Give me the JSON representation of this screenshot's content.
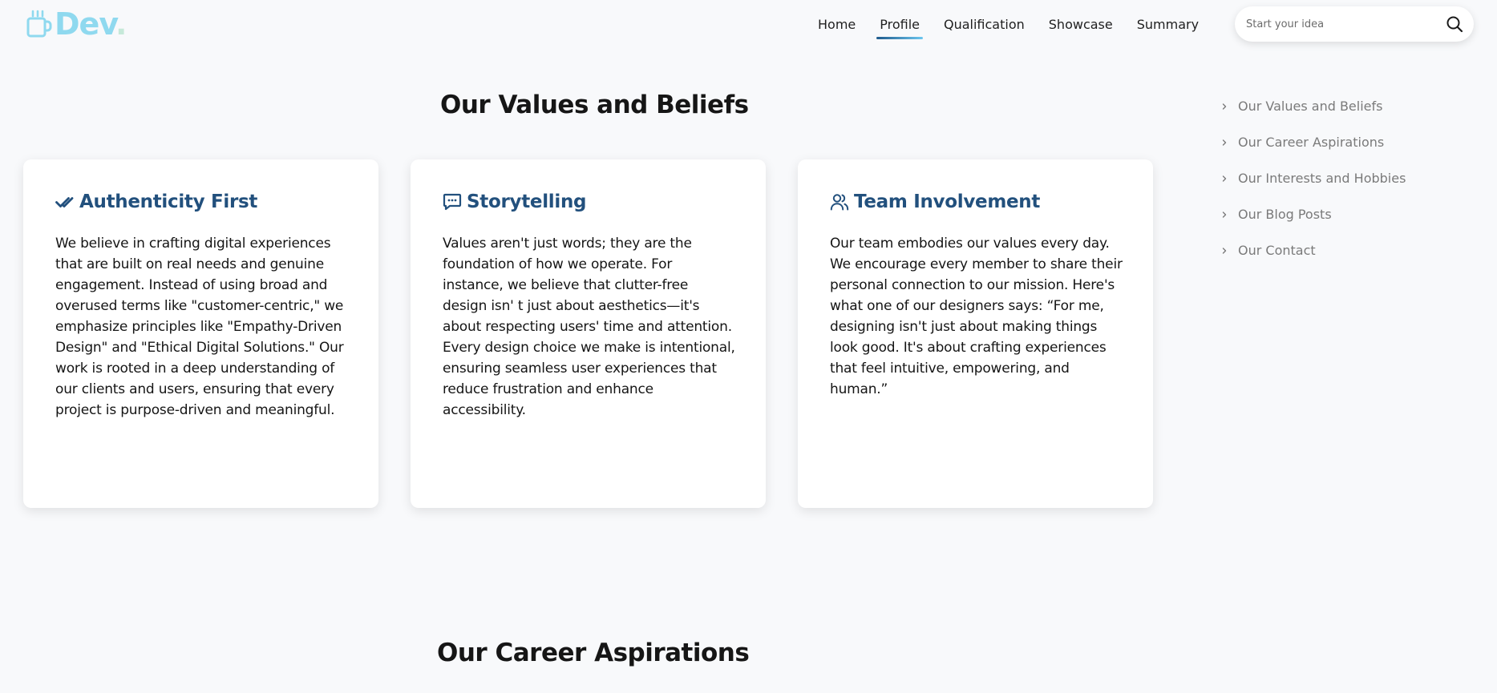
{
  "brand": {
    "name": "Dev",
    "dot": ".",
    "icon": "coffee-mug-icon",
    "color": "#8fd9ef"
  },
  "nav": {
    "items": [
      {
        "label": "Home",
        "active": false
      },
      {
        "label": "Profile",
        "active": true
      },
      {
        "label": "Qualification",
        "active": false
      },
      {
        "label": "Showcase",
        "active": false
      },
      {
        "label": "Summary",
        "active": false
      }
    ]
  },
  "search": {
    "placeholder": "Start your idea",
    "icon": "search-icon"
  },
  "sections": {
    "values_title": "Our Values and Beliefs",
    "career_title": "Our Career Aspirations"
  },
  "cards": [
    {
      "icon": "double-check-icon",
      "title": "Authenticity First",
      "text": "We believe in crafting digital experiences that are built on real needs and genuine engagement. Instead of using broad and overused terms like \"customer-centric,\" we emphasize principles like \"Empathy-Driven Design\" and \"Ethical Digital Solutions.\" Our work is rooted in a deep understanding of our clients and users, ensuring that every project is purpose-driven and meaningful."
    },
    {
      "icon": "chat-bubble-icon",
      "title": "Storytelling",
      "text": "Values aren't just words; they are the foundation of how we operate. For instance, we believe that clutter-free design isn' t just about aesthetics—it's about respecting users' time and attention. Every design choice we make is intentional, ensuring seamless user experiences that reduce frustration and enhance accessibility."
    },
    {
      "icon": "user-group-icon",
      "title": "Team Involvement",
      "text": "Our team embodies our values every day. We encourage every member to share their personal connection to our mission. Here's what one of our designers says: “For me, designing isn't just about making things look good. It's about crafting experiences that feel intuitive, empowering, and human.”"
    }
  ],
  "toc": {
    "items": [
      "Our Values and Beliefs",
      "Our Career Aspirations",
      "Our Interests and Hobbies",
      "Our Blog Posts",
      "Our Contact"
    ]
  },
  "colors": {
    "page_bg": "#f8f9fb",
    "card_title": "#22507d",
    "toc_text": "#7a7a7a",
    "nav_underline_start": "#1e5a8c",
    "nav_underline_end": "#6cc6ef"
  }
}
